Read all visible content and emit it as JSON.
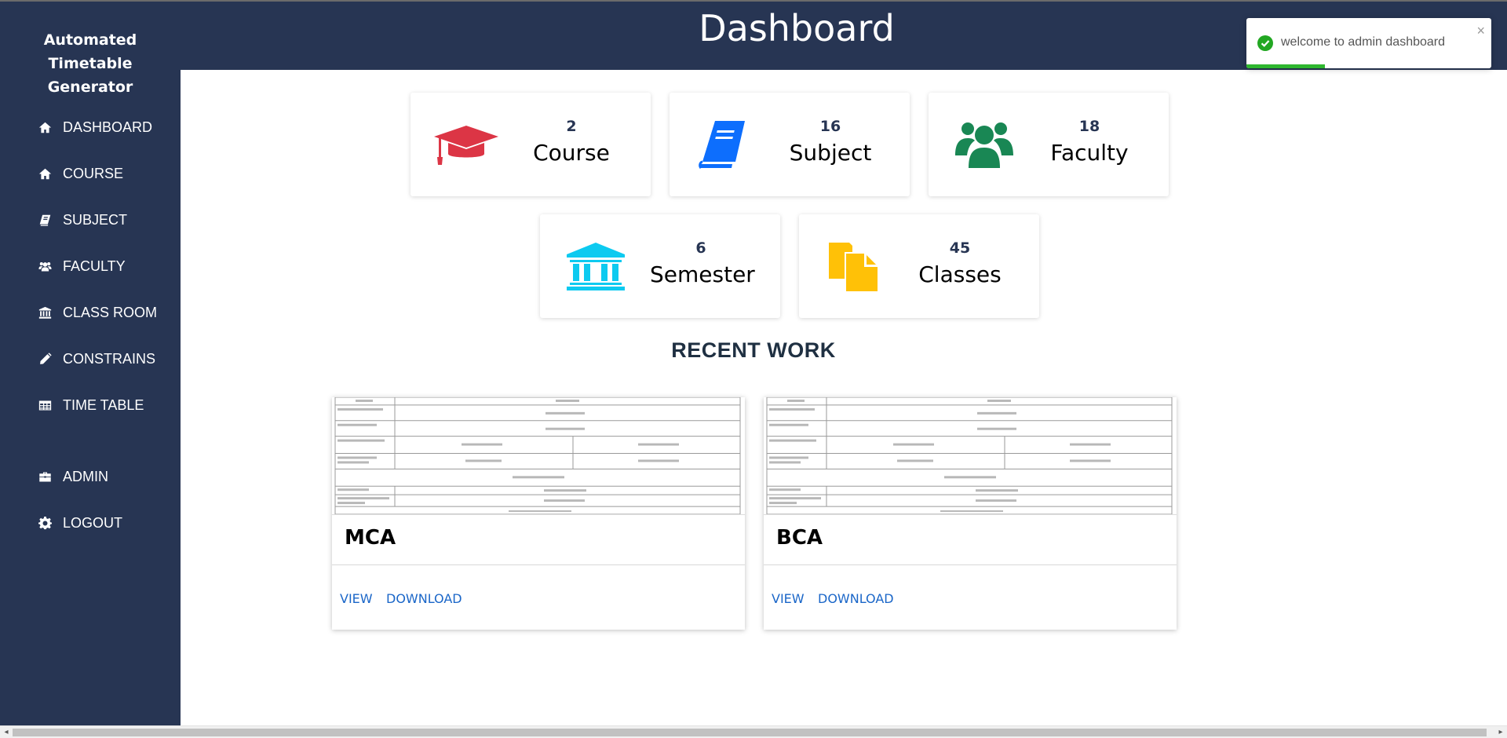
{
  "sidebar": {
    "brand_line1": "Automated Timetable",
    "brand_line2": "Generator",
    "items": [
      {
        "label": "DASHBOARD",
        "icon": "home-icon"
      },
      {
        "label": "COURSE",
        "icon": "home-icon"
      },
      {
        "label": "SUBJECT",
        "icon": "book-icon"
      },
      {
        "label": "FACULTY",
        "icon": "users-icon"
      },
      {
        "label": "CLASS ROOM",
        "icon": "institution-icon"
      },
      {
        "label": "CONSTRAINS",
        "icon": "pencil-icon"
      },
      {
        "label": "TIME TABLE",
        "icon": "table-icon"
      },
      {
        "label": "ADMIN",
        "icon": "briefcase-icon"
      },
      {
        "label": "LOGOUT",
        "icon": "gear-icon"
      }
    ]
  },
  "header": {
    "title": "Dashboard"
  },
  "stats": [
    {
      "value": "2",
      "label": "Course",
      "icon": "graduation-cap-icon",
      "color": "#dc3545"
    },
    {
      "value": "16",
      "label": "Subject",
      "icon": "book-icon",
      "color": "#0d6efd"
    },
    {
      "value": "18",
      "label": "Faculty",
      "icon": "users-icon",
      "color": "#198754"
    },
    {
      "value": "6",
      "label": "Semester",
      "icon": "institution-icon",
      "color": "#0dcaf0"
    },
    {
      "value": "45",
      "label": "Classes",
      "icon": "files-icon",
      "color": "#ffc107"
    }
  ],
  "recent": {
    "title": "RECENT WORK",
    "cards": [
      {
        "name": "MCA",
        "view": "VIEW",
        "download": "DOWNLOAD"
      },
      {
        "name": "BCA",
        "view": "VIEW",
        "download": "DOWNLOAD"
      }
    ]
  },
  "toast": {
    "message": "welcome to admin dashboard",
    "close": "×",
    "progress": 0.32,
    "color": "#2fb72f"
  },
  "colors": {
    "sidebar": "#273553",
    "accent_link": "#1a66c8"
  }
}
